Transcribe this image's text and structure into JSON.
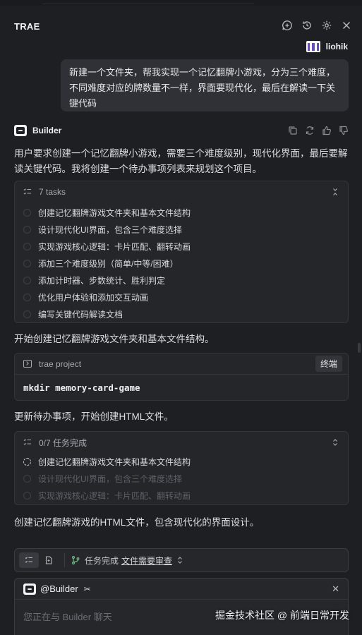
{
  "app": {
    "title": "TRAE"
  },
  "user": {
    "name": "liohik",
    "message": "新建一个文件夹，帮我实现一个记忆翻牌小游戏，分为三个难度，不同难度对应的牌数量不一样，界面要现代化，最后在解读一下关键代码"
  },
  "assistant": {
    "name": "Builder"
  },
  "messages": {
    "intro": "用户要求创建一个记忆翻牌小游戏，需要三个难度级别，现代化界面，最后要解读关键代码。我将创建一个待办事项列表来规划这个项目。",
    "step1": "开始创建记忆翻牌游戏文件夹和基本文件结构。",
    "step2": "更新待办事项，开始创建HTML文件。",
    "step3": "创建记忆翻牌游戏的HTML文件，包含现代化的界面设计。"
  },
  "todo_panel": {
    "header": "7 tasks",
    "tasks": [
      "创建记忆翻牌游戏文件夹和基本文件结构",
      "设计现代化UI界面，包含三个难度选择",
      "实现游戏核心逻辑：卡片匹配、翻转动画",
      "添加三个难度级别（简单/中等/困难）",
      "添加计时器、步数统计、胜利判定",
      "优化用户体验和添加交互动画",
      "编写关键代码解读文档"
    ]
  },
  "terminal": {
    "label": "trae project",
    "button": "终端",
    "command": "mkdir memory-card-game"
  },
  "progress_panel": {
    "header": "0/7 任务完成",
    "tasks": [
      "创建记忆翻牌游戏文件夹和基本文件结构",
      "设计现代化UI界面，包含三个难度选择",
      "实现游戏核心逻辑：卡片匹配、翻转动画"
    ]
  },
  "toolbar": {
    "status": "任务完成",
    "review_link": "文件需要审查"
  },
  "chat": {
    "agent": "@Builder",
    "placeholder": "您正在与 Builder 聊天"
  },
  "watermark": "掘金技术社区 @ 前端日常开发"
}
